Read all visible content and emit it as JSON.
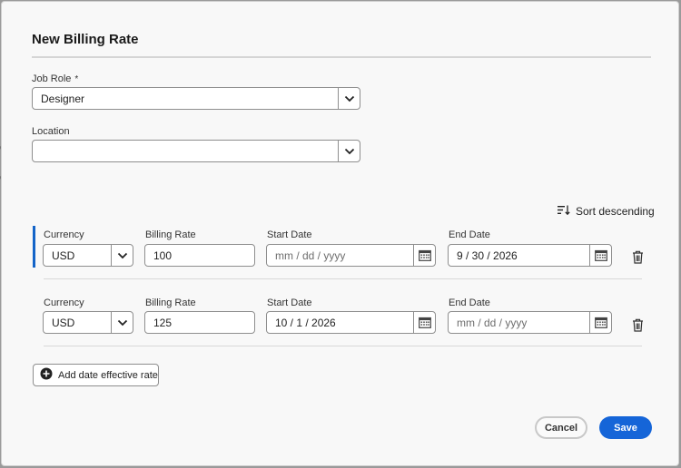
{
  "backdrop": {
    "edge_char_1": "e",
    "edge_char_2": "e"
  },
  "dialog": {
    "title": "New Billing Rate",
    "job_role": {
      "label": "Job Role",
      "required_marker": "*",
      "value": "Designer"
    },
    "location": {
      "label": "Location",
      "value": ""
    },
    "sort_label": "Sort descending",
    "rates": [
      {
        "currency_label": "Currency",
        "currency": "USD",
        "billing_rate_label": "Billing Rate",
        "billing_rate": "100",
        "start_date_label": "Start Date",
        "start_date": "",
        "start_date_placeholder": "mm / dd / yyyy",
        "end_date_label": "End Date",
        "end_date": "9 / 30 / 2026",
        "end_date_placeholder": "mm / dd / yyyy",
        "selected": true
      },
      {
        "currency_label": "Currency",
        "currency": "USD",
        "billing_rate_label": "Billing Rate",
        "billing_rate": "125",
        "start_date_label": "Start Date",
        "start_date": "10 / 1 / 2026",
        "start_date_placeholder": "mm / dd / yyyy",
        "end_date_label": "End Date",
        "end_date": "",
        "end_date_placeholder": "mm / dd / yyyy",
        "selected": false
      }
    ],
    "add_rate_label": "Add date effective rate",
    "cancel_label": "Cancel",
    "save_label": "Save"
  },
  "colors": {
    "accent": "#1565d8",
    "row_marker": "#1464c8"
  }
}
